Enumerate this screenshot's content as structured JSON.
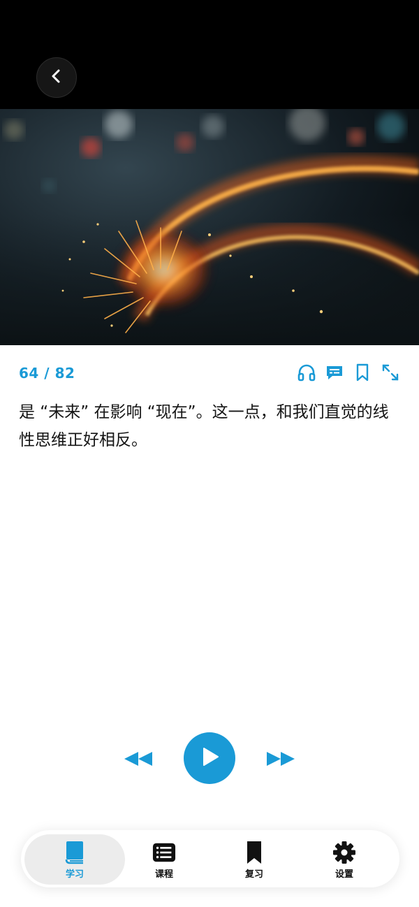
{
  "header": {
    "back_icon": "chevron-left-icon"
  },
  "hero": {
    "description_icon": "hero-image"
  },
  "reader": {
    "progress": "64 / 82",
    "passage": "是 “未来” 在影响 “现在”。这一点，和我们直觉的线性思维正好相反。"
  },
  "toolbar": {
    "icons": [
      "headphones-icon",
      "chat-icon",
      "bookmark-icon",
      "expand-icon"
    ],
    "accent": "#1a9ad6"
  },
  "player": {
    "rewind_icon": "rewind-icon",
    "play_icon": "play-icon",
    "forward_icon": "fast-forward-icon",
    "accent": "#1a9ad6"
  },
  "tabs": [
    {
      "label": "学习",
      "icon": "book-icon",
      "active": true
    },
    {
      "label": "课程",
      "icon": "list-icon",
      "active": false
    },
    {
      "label": "复习",
      "icon": "bookmark-icon",
      "active": false
    },
    {
      "label": "设置",
      "icon": "gear-icon",
      "active": false
    }
  ]
}
